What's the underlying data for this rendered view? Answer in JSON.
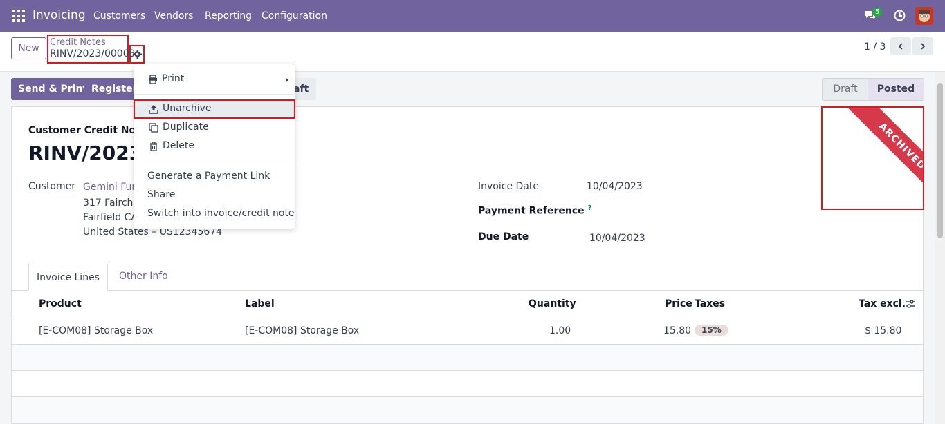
{
  "navbar": {
    "app_name": "Invoicing",
    "menus": [
      "Customers",
      "Vendors",
      "Reporting",
      "Configuration"
    ],
    "chat_count": "5",
    "accent": "#71639e"
  },
  "control": {
    "new_label": "New",
    "breadcrumb_parent": "Credit Notes",
    "breadcrumb_current": "RINV/2023/00003",
    "pager": "1 / 3"
  },
  "actions": {
    "send_print": "Send & Print",
    "register": "Register",
    "reset_draft_fragment": "aft",
    "status_draft": "Draft",
    "status_posted": "Posted"
  },
  "form": {
    "subtitle": "Customer Credit Note",
    "title": "RINV/2023/",
    "customer_label": "Customer",
    "customer_name": "Gemini Furr",
    "address_line1": "317 Fairchil",
    "address_line2": "Fairfield CA",
    "address_line3": "United States – US12345674",
    "invoice_date_label": "Invoice Date",
    "invoice_date": "10/04/2023",
    "payment_ref_label": "Payment Reference",
    "payment_ref_help": "?",
    "due_date_label": "Due Date",
    "due_date": "10/04/2023",
    "ribbon": "ARCHIVED"
  },
  "tabs": [
    "Invoice Lines",
    "Other Info"
  ],
  "table": {
    "headers": [
      "Product",
      "Label",
      "Quantity",
      "Price",
      "Taxes",
      "Tax excl."
    ],
    "rows": [
      {
        "product": "[E-COM08] Storage Box",
        "label": "[E-COM08] Storage Box",
        "quantity": "1.00",
        "price": "15.80",
        "taxes": "15%",
        "tax_excl": "$ 15.80"
      }
    ]
  },
  "dropdown": {
    "items": [
      "Print",
      "Unarchive",
      "Duplicate",
      "Delete",
      "Generate a Payment Link",
      "Share",
      "Switch into invoice/credit note"
    ]
  }
}
